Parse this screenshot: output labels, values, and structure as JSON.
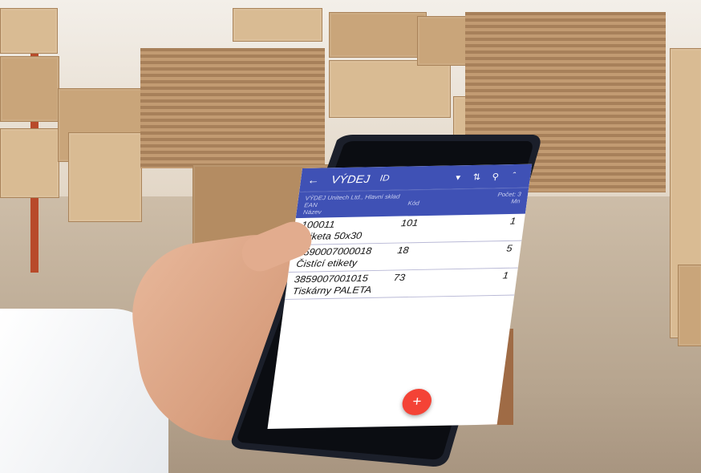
{
  "app": {
    "title": "VÝDEJ",
    "sort_field": "ID",
    "colors": {
      "primary": "#3f51b5",
      "fab": "#f44336"
    }
  },
  "toolbar": {
    "back_icon": "arrow-left-icon",
    "dropdown_icon": "caret-down-icon",
    "sort_icon": "sort-icon",
    "search_icon": "search-icon",
    "collapse_icon": "chevron-up-icon"
  },
  "header": {
    "doc_line": "VÝDEJ Unitech Ltd., Hlavní sklad",
    "col_ean": "EAN",
    "col_name": "Název",
    "col_code": "Kód",
    "count_label": "Počet: 3",
    "col_qty": "Mn"
  },
  "items": [
    {
      "ean": "100011",
      "code": "101",
      "qty": "1",
      "name": "Etiketa 50x30"
    },
    {
      "ean": "8590007000018",
      "code": "18",
      "qty": "5",
      "name": "Čistící etikety"
    },
    {
      "ean": "3859007001015",
      "code": "73",
      "qty": "1",
      "name": "Tiskárny PALETA"
    }
  ],
  "fab": {
    "label": "+",
    "icon": "plus-icon"
  }
}
